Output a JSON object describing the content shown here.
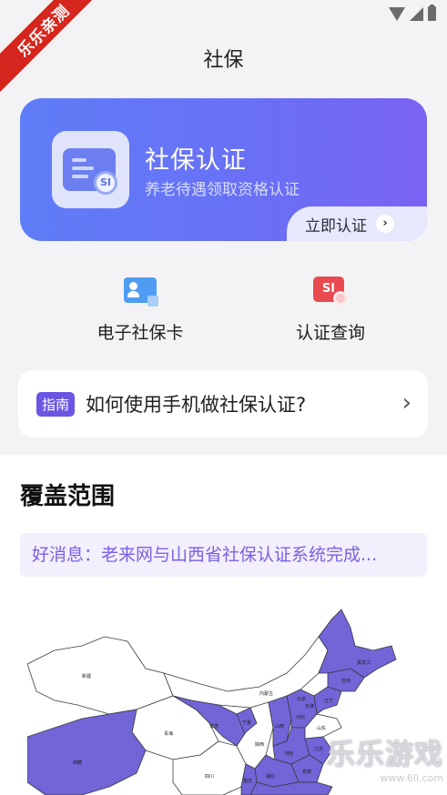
{
  "watermark": {
    "ribbon_text": "乐乐亲测",
    "brand_text": "乐乐游戏",
    "brand_url": "www.6ll.com"
  },
  "header": {
    "title": "社保"
  },
  "auth_card": {
    "title": "社保认证",
    "subtitle": "养老待遇领取资格认证",
    "action_label": "立即认证",
    "seal_text": "SI"
  },
  "quick_entries": [
    {
      "label": "电子社保卡",
      "icon": "id-card-icon"
    },
    {
      "label": "认证查询",
      "icon": "certificate-search-icon"
    }
  ],
  "guide": {
    "tag": "指南",
    "text": "如何使用手机做社保认证?"
  },
  "coverage": {
    "title": "覆盖范围",
    "news": "好消息：老来网与山西省社保认证系统完成...",
    "map_labels": [
      "黑龙江",
      "吉林",
      "辽宁",
      "内蒙古",
      "北京",
      "天津",
      "河北",
      "山西",
      "山东",
      "青海",
      "甘肃",
      "宁夏",
      "陕西",
      "河南",
      "江苏",
      "四川",
      "重庆",
      "湖北",
      "安徽",
      "新疆",
      "西藏"
    ]
  },
  "colors": {
    "accent": "#6a6ff5",
    "map_fill": "#7165d8",
    "tag": "#6a56e3"
  }
}
